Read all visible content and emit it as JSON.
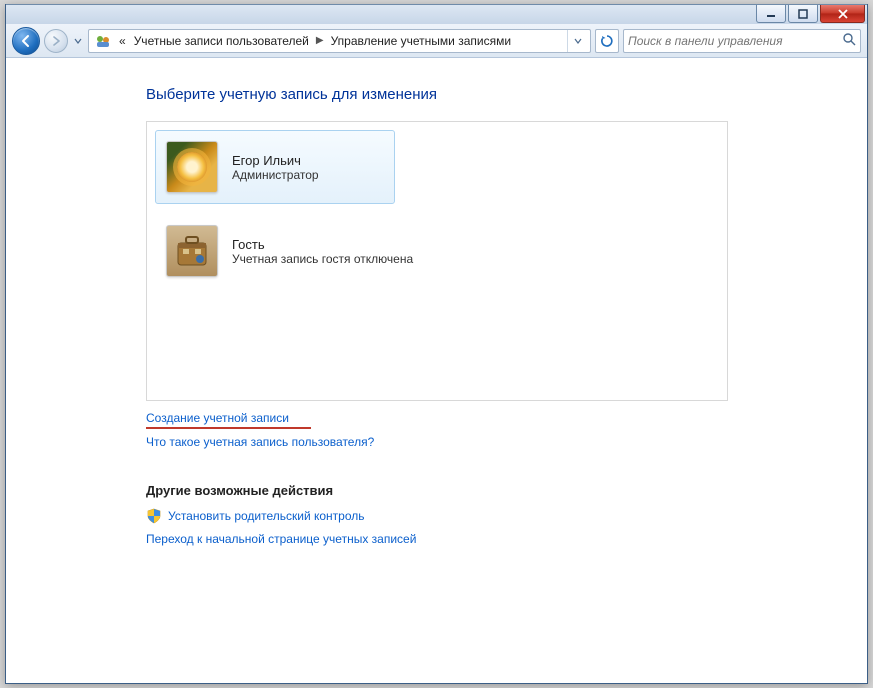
{
  "breadcrumb": {
    "prefix": "«",
    "seg1": "Учетные записи пользователей",
    "seg2": "Управление учетными записями"
  },
  "search": {
    "placeholder": "Поиск в панели управления"
  },
  "heading": "Выберите учетную запись для изменения",
  "accounts": [
    {
      "name": "Егор Ильич",
      "role": "Администратор"
    },
    {
      "name": "Гость",
      "role": "Учетная запись гостя отключена"
    }
  ],
  "links": {
    "create": "Создание учетной записи",
    "whatis": "Что такое учетная запись пользователя?"
  },
  "other": {
    "title": "Другие возможные действия",
    "parental": "Установить родительский контроль",
    "gohome": "Переход к начальной странице учетных записей"
  }
}
